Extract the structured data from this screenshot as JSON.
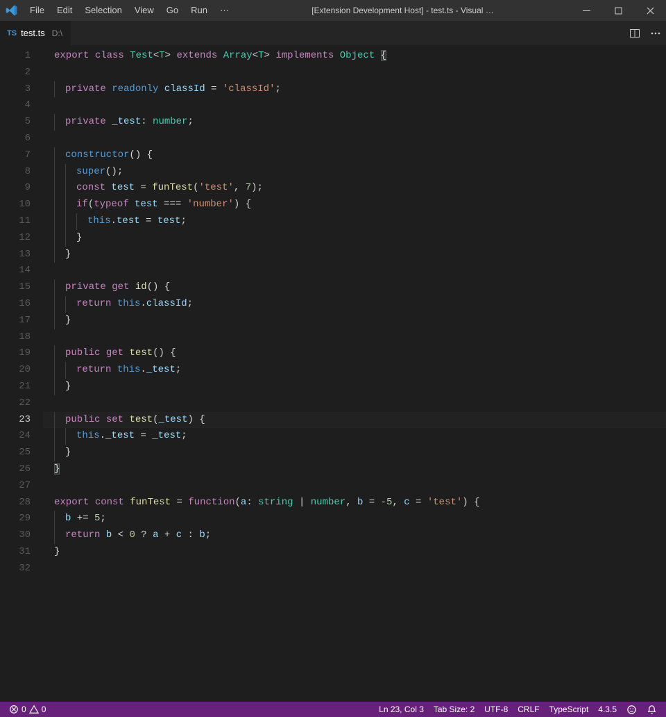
{
  "menu": {
    "file": "File",
    "edit": "Edit",
    "selection": "Selection",
    "view": "View",
    "go": "Go",
    "run": "Run",
    "more": "···"
  },
  "window_title": "[Extension Development Host] - test.ts - Visual …",
  "tab": {
    "badge": "TS",
    "name": "test.ts",
    "path": "D:\\"
  },
  "gutter_lines": [
    "1",
    "2",
    "3",
    "4",
    "5",
    "6",
    "7",
    "8",
    "9",
    "10",
    "11",
    "12",
    "13",
    "14",
    "15",
    "16",
    "17",
    "18",
    "19",
    "20",
    "21",
    "22",
    "23",
    "24",
    "25",
    "26",
    "27",
    "28",
    "29",
    "30",
    "31",
    "32"
  ],
  "active_line_index": 22,
  "code": {
    "t": {
      "export": "export",
      "class": "class",
      "Test": "Test",
      "LT": "<",
      "T": "T",
      "GT": ">",
      "extends": "extends",
      "Array": "Array",
      "implements": "implements",
      "Object": "Object",
      "lbrace": "{",
      "rbrace": "}",
      "private": "private",
      "readonly": "readonly",
      "classIdProp": "classId",
      "eq": " = ",
      "strClassId": "'classId'",
      "semi": ";",
      "underscoreTest": "_test",
      "colonSp": ": ",
      "number": "number",
      "constructor": "constructor",
      "parens": "()",
      "sp": " ",
      "super": "super",
      "const": "const",
      "testVar": "test",
      "funTest": "funTest",
      "lpar": "(",
      "strTest": "'test'",
      "comma": ", ",
      "seven": "7",
      "rpar": ")",
      "if": "if",
      "typeof": "typeof",
      "tripleEq": " === ",
      "strNumber": "'number'",
      "this": "this",
      "dot": ".",
      "get": "get",
      "id": "id",
      "return": "return",
      "public": "public",
      "set": "set",
      "function": "function",
      "aParam": "a",
      "colon": ": ",
      "stringType": "string",
      "pipe": " | ",
      "bParam": "b",
      "eqm5": " = -5",
      "cParam": "c",
      "eqTest": " = 'test'",
      "minus5": "-5",
      "testStr2": "'test'",
      "plusEq": " += ",
      "five": "5",
      "zero": "0",
      "lt": " < ",
      "qmark": " ? ",
      "plus": " + ",
      "colonTern": " : "
    }
  },
  "status": {
    "errors": "0",
    "warnings": "0",
    "lncol": "Ln 23, Col 3",
    "tabsize": "Tab Size: 2",
    "encoding": "UTF-8",
    "eol": "CRLF",
    "lang": "TypeScript",
    "tsver": "4.3.5"
  }
}
